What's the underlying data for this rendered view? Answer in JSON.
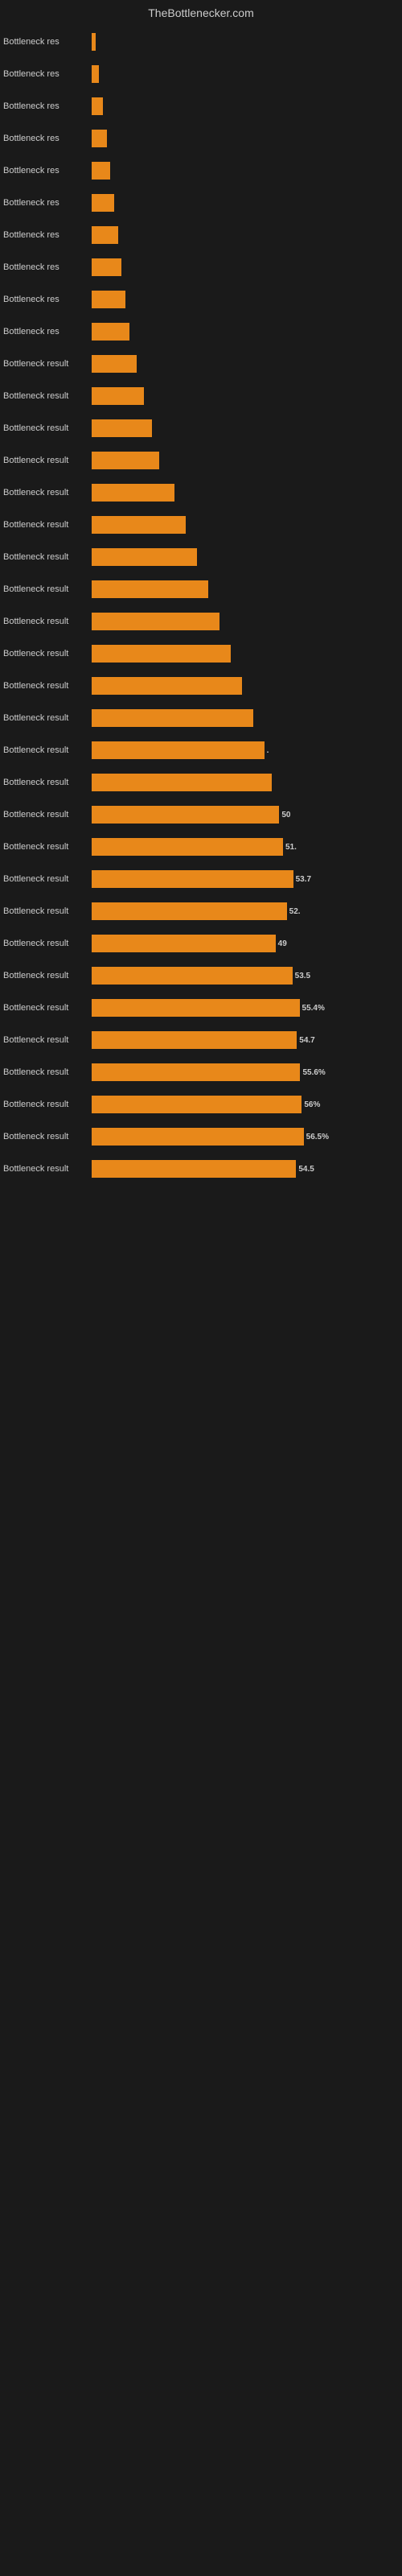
{
  "header": {
    "title": "TheBottlenecker.com"
  },
  "bars": [
    {
      "label": "Bottleneck res",
      "value": null,
      "width_pct": 1,
      "show_value": false
    },
    {
      "label": "Bottleneck res",
      "value": null,
      "width_pct": 2,
      "show_value": false
    },
    {
      "label": "Bottleneck res",
      "value": null,
      "width_pct": 3,
      "show_value": false
    },
    {
      "label": "Bottleneck res",
      "value": null,
      "width_pct": 4,
      "show_value": false
    },
    {
      "label": "Bottleneck res",
      "value": null,
      "width_pct": 5,
      "show_value": false
    },
    {
      "label": "Bottleneck res",
      "value": null,
      "width_pct": 6,
      "show_value": false
    },
    {
      "label": "Bottleneck res",
      "value": null,
      "width_pct": 7,
      "show_value": false
    },
    {
      "label": "Bottleneck res",
      "value": null,
      "width_pct": 8,
      "show_value": false
    },
    {
      "label": "Bottleneck res",
      "value": null,
      "width_pct": 9,
      "show_value": false
    },
    {
      "label": "Bottleneck res",
      "value": null,
      "width_pct": 10,
      "show_value": false
    },
    {
      "label": "Bottleneck result",
      "value": null,
      "width_pct": 12,
      "show_value": false
    },
    {
      "label": "Bottleneck result",
      "value": null,
      "width_pct": 14,
      "show_value": false
    },
    {
      "label": "Bottleneck result",
      "value": null,
      "width_pct": 16,
      "show_value": false
    },
    {
      "label": "Bottleneck result",
      "value": null,
      "width_pct": 18,
      "show_value": false
    },
    {
      "label": "Bottleneck result",
      "value": null,
      "width_pct": 22,
      "show_value": false
    },
    {
      "label": "Bottleneck result",
      "value": null,
      "width_pct": 25,
      "show_value": false
    },
    {
      "label": "Bottleneck result",
      "value": null,
      "width_pct": 28,
      "show_value": false
    },
    {
      "label": "Bottleneck result",
      "value": null,
      "width_pct": 31,
      "show_value": false
    },
    {
      "label": "Bottleneck result",
      "value": null,
      "width_pct": 34,
      "show_value": false
    },
    {
      "label": "Bottleneck result",
      "value": null,
      "width_pct": 37,
      "show_value": false
    },
    {
      "label": "Bottleneck result",
      "value": null,
      "width_pct": 40,
      "show_value": false
    },
    {
      "label": "Bottleneck result",
      "value": null,
      "width_pct": 43,
      "show_value": false
    },
    {
      "label": "Bottleneck result",
      "value": ".",
      "width_pct": 46,
      "show_value": true,
      "outside": true
    },
    {
      "label": "Bottleneck result",
      "value": null,
      "width_pct": 48,
      "show_value": false
    },
    {
      "label": "Bottleneck result",
      "value": "50",
      "width_pct": 50,
      "show_value": true,
      "outside": true
    },
    {
      "label": "Bottleneck result",
      "value": "51.",
      "width_pct": 51,
      "show_value": true,
      "outside": true
    },
    {
      "label": "Bottleneck result",
      "value": "53.7",
      "width_pct": 53.7,
      "show_value": true,
      "outside": true
    },
    {
      "label": "Bottleneck result",
      "value": "52.",
      "width_pct": 52,
      "show_value": true,
      "outside": true
    },
    {
      "label": "Bottleneck result",
      "value": "49",
      "width_pct": 49,
      "show_value": true,
      "outside": true
    },
    {
      "label": "Bottleneck result",
      "value": "53.5",
      "width_pct": 53.5,
      "show_value": true,
      "outside": true
    },
    {
      "label": "Bottleneck result",
      "value": "55.4%",
      "width_pct": 55.4,
      "show_value": true,
      "outside": true
    },
    {
      "label": "Bottleneck result",
      "value": "54.7",
      "width_pct": 54.7,
      "show_value": true,
      "outside": true
    },
    {
      "label": "Bottleneck result",
      "value": "55.6%",
      "width_pct": 55.6,
      "show_value": true,
      "outside": true
    },
    {
      "label": "Bottleneck result",
      "value": "56%",
      "width_pct": 56,
      "show_value": true,
      "outside": true
    },
    {
      "label": "Bottleneck result",
      "value": "56.5%",
      "width_pct": 56.5,
      "show_value": true,
      "outside": true
    },
    {
      "label": "Bottleneck result",
      "value": "54.5",
      "width_pct": 54.5,
      "show_value": true,
      "outside": true
    }
  ]
}
